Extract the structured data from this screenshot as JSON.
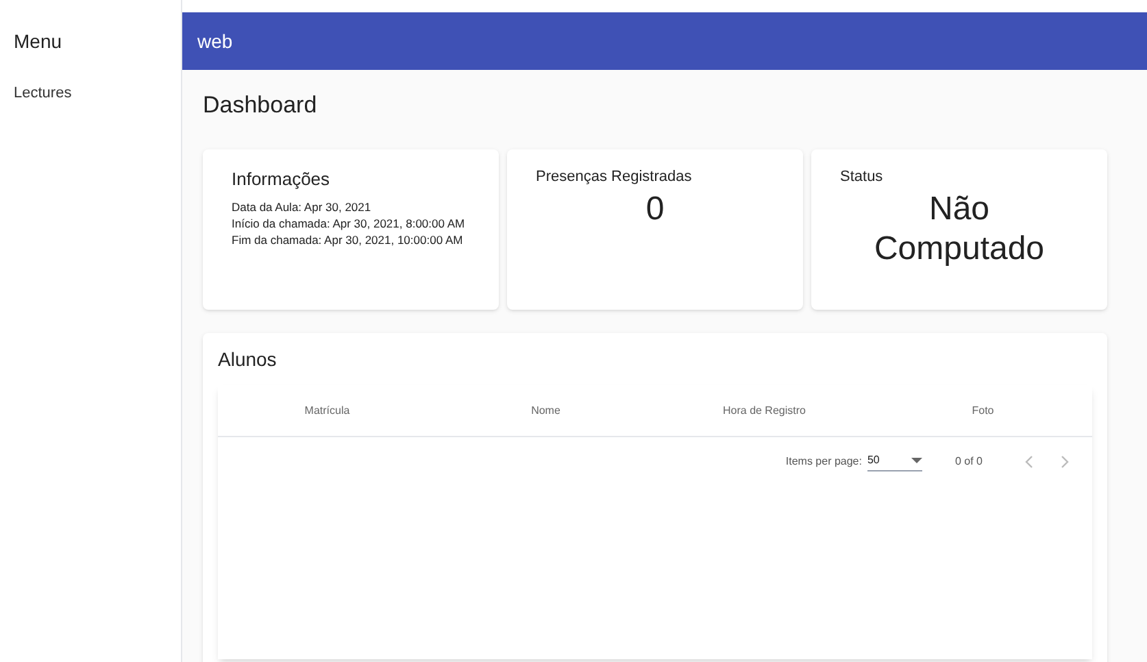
{
  "sidebar": {
    "title": "Menu",
    "items": [
      {
        "label": "Lectures"
      }
    ]
  },
  "toolbar": {
    "title": "web"
  },
  "page_title": "Dashboard",
  "cards": [
    {
      "kind": "info",
      "title": "Informações",
      "lines": [
        "Data da Aula: Apr 30, 2021",
        "Início da chamada: Apr 30, 2021, 8:00:00 AM",
        "Fim da chamada: Apr 30, 2021, 10:00:00 AM"
      ]
    },
    {
      "kind": "stat",
      "title": "Presenças Registradas",
      "value": "0"
    },
    {
      "kind": "stat",
      "title": "Status",
      "value": "Não Computado"
    }
  ],
  "students": {
    "title": "Alunos",
    "columns": [
      "Matrícula",
      "Nome",
      "Hora de Registro",
      "Foto"
    ],
    "paginator": {
      "label": "Items per page:",
      "page_size": "50",
      "range": "0 of 0",
      "previous_disabled": true,
      "next_disabled": true
    }
  }
}
